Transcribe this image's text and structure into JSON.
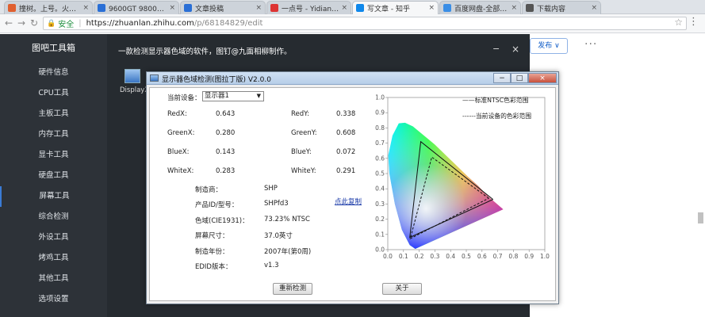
{
  "browser": {
    "tabs": [
      {
        "title": "撞树。上号。火行...",
        "color": "#e06030",
        "active": false
      },
      {
        "title": "9600GT 9800核心...",
        "color": "#2a6fd6",
        "active": false
      },
      {
        "title": "文章投稿",
        "color": "#2a6fd6",
        "active": false
      },
      {
        "title": "一点号 - Yidianzix...",
        "color": "#d33",
        "active": false
      },
      {
        "title": "写文章 - 知乎",
        "color": "#0f88eb",
        "active": true
      },
      {
        "title": "百度网盘-全部文件",
        "color": "#3a8ee6",
        "active": false
      },
      {
        "title": "下载内容",
        "color": "#555",
        "active": false
      }
    ],
    "secure_label": "安全",
    "url_host": "https://zhuanlan.zhihu.com",
    "url_path": "/p/68184829/edit",
    "icons": {
      "back": "back-arrow-icon",
      "forward": "forward-arrow-icon",
      "reload": "reload-icon",
      "star": "star-icon",
      "menu": "kebab-menu-icon"
    }
  },
  "sidebar": {
    "title": "图吧工具箱",
    "items": [
      "硬件信息",
      "CPU工具",
      "主板工具",
      "内存工具",
      "显卡工具",
      "硬盘工具",
      "屏幕工具",
      "综合检测",
      "外设工具",
      "烤鸡工具",
      "其他工具",
      "选项设置"
    ],
    "active_index": 6
  },
  "main": {
    "header": "一款检测显示器色域的软件，图钉@九面相柳制作。",
    "min_glyph": "−",
    "close_glyph": "×",
    "app_label": "DisplayX"
  },
  "right": {
    "publish_label": "发布",
    "publish_caret": "∨",
    "more_glyph": "···"
  },
  "dialog": {
    "title": "显示器色域检测(图拉丁版) V2.0.0",
    "ctl_min": "−",
    "ctl_max": "□",
    "ctl_close": "×",
    "device_label": "当前设备：",
    "device_value": "显示器1",
    "readings": [
      {
        "label": "RedX:",
        "value": "0.643"
      },
      {
        "label": "RedY:",
        "value": "0.338"
      },
      {
        "label": "GreenX:",
        "value": "0.280"
      },
      {
        "label": "GreenY:",
        "value": "0.608"
      },
      {
        "label": "BlueX:",
        "value": "0.143"
      },
      {
        "label": "BlueY:",
        "value": "0.072"
      },
      {
        "label": "WhiteX:",
        "value": "0.283"
      },
      {
        "label": "WhiteY:",
        "value": "0.291"
      }
    ],
    "info": [
      {
        "label": "制造商：",
        "value": "SHP"
      },
      {
        "label": "产品ID/型号：",
        "value": "SHPfd3"
      },
      {
        "label": "色域(CIE1931)：",
        "value": "73.23% NTSC"
      },
      {
        "label": "屏幕尺寸：",
        "value": "37.0英寸"
      },
      {
        "label": "制造年份：",
        "value": "2007年(第0周)"
      },
      {
        "label": "EDID版本：",
        "value": "v1.3"
      }
    ],
    "copy_link": "点此复制",
    "btn_redetect": "重新检测",
    "btn_about": "关于"
  },
  "chart_data": {
    "type": "scatter",
    "title": "",
    "xlim": [
      0,
      1.0
    ],
    "ylim": [
      0,
      1.0
    ],
    "x_ticks": [
      "0.0",
      "0.1",
      "0.2",
      "0.3",
      "0.4",
      "0.5",
      "0.6",
      "0.7",
      "0.8",
      "0.9",
      "1.0"
    ],
    "y_ticks": [
      "0.0",
      "0.1",
      "0.2",
      "0.3",
      "0.4",
      "0.5",
      "0.6",
      "0.7",
      "0.8",
      "0.9",
      "1.0"
    ],
    "legend": [
      "——标准NTSC色彩范围",
      "------当前设备的色彩范围"
    ],
    "legend_position": "top-right",
    "series": [
      {
        "name": "——标准NTSC色彩范围",
        "x": [
          0.67,
          0.21,
          0.14,
          0.67
        ],
        "y": [
          0.33,
          0.71,
          0.08,
          0.33
        ]
      },
      {
        "name": "------当前设备的色彩范围",
        "x": [
          0.643,
          0.28,
          0.143,
          0.643
        ],
        "y": [
          0.338,
          0.608,
          0.072,
          0.338
        ]
      }
    ],
    "locus": {
      "x": [
        0.175,
        0.14,
        0.09,
        0.045,
        0.01,
        0.003,
        0.03,
        0.07,
        0.11,
        0.16,
        0.23,
        0.3,
        0.37,
        0.44,
        0.51,
        0.575,
        0.62,
        0.65,
        0.7347,
        0.175
      ],
      "y": [
        0.005,
        0.03,
        0.13,
        0.3,
        0.5,
        0.62,
        0.75,
        0.83,
        0.834,
        0.81,
        0.75,
        0.69,
        0.62,
        0.55,
        0.48,
        0.42,
        0.37,
        0.34,
        0.265,
        0.005
      ]
    }
  }
}
